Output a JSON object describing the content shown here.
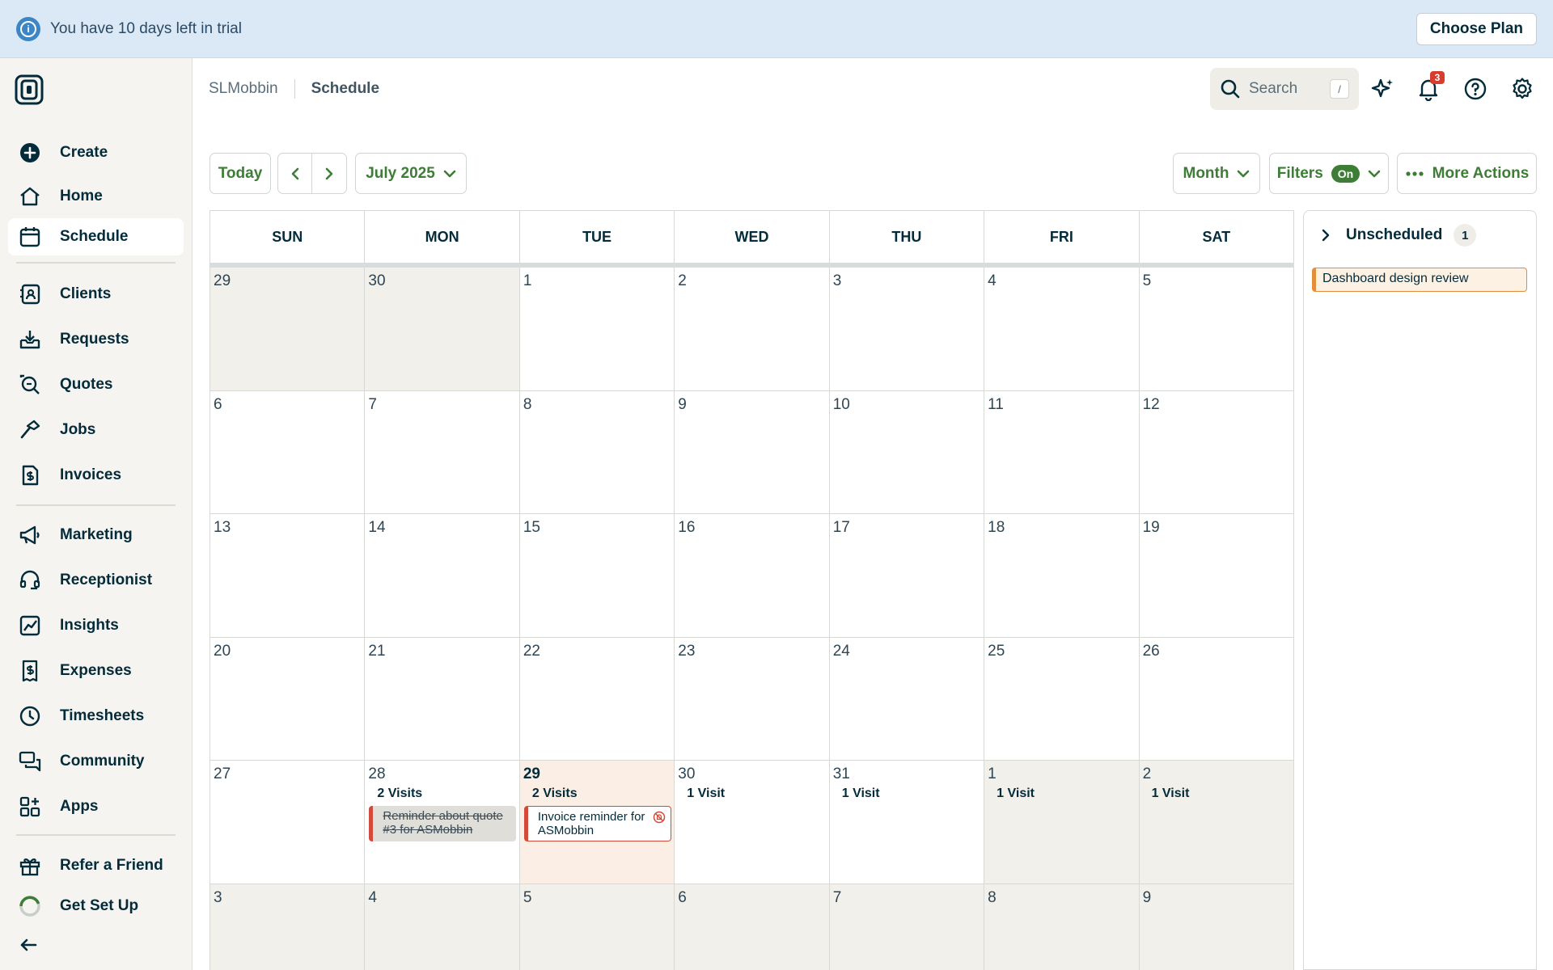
{
  "banner": {
    "message": "You have 10 days left in trial",
    "button": "Choose Plan"
  },
  "sidebar": {
    "items": [
      {
        "label": "Create",
        "icon": "plus-circle-icon"
      },
      {
        "label": "Home",
        "icon": "home-icon"
      },
      {
        "label": "Schedule",
        "icon": "calendar-icon",
        "active": true
      },
      {
        "label": "Clients",
        "icon": "address-book-icon"
      },
      {
        "label": "Requests",
        "icon": "inbox-download-icon"
      },
      {
        "label": "Quotes",
        "icon": "quote-search-icon"
      },
      {
        "label": "Jobs",
        "icon": "hammer-icon"
      },
      {
        "label": "Invoices",
        "icon": "invoice-dollar-icon"
      },
      {
        "label": "Marketing",
        "icon": "megaphone-icon"
      },
      {
        "label": "Receptionist",
        "icon": "headset-icon"
      },
      {
        "label": "Insights",
        "icon": "chart-icon"
      },
      {
        "label": "Expenses",
        "icon": "receipt-dollar-icon"
      },
      {
        "label": "Timesheets",
        "icon": "clock-icon"
      },
      {
        "label": "Community",
        "icon": "chat-bubbles-icon"
      },
      {
        "label": "Apps",
        "icon": "apps-grid-icon"
      },
      {
        "label": "Refer a Friend",
        "icon": "gift-icon"
      },
      {
        "label": "Get Set Up",
        "icon": "progress-ring-icon"
      }
    ]
  },
  "header": {
    "company": "SLMobbin",
    "page": "Schedule",
    "search_placeholder": "Search",
    "search_shortcut": "/",
    "notification_count": "3"
  },
  "toolbar": {
    "today": "Today",
    "month_label": "July 2025",
    "view": "Month",
    "filters": "Filters",
    "filters_state": "On",
    "more_actions": "More Actions"
  },
  "calendar": {
    "weekdays": [
      "SUN",
      "MON",
      "TUE",
      "WED",
      "THU",
      "FRI",
      "SAT"
    ],
    "weeks": [
      [
        {
          "d": "29",
          "out": true
        },
        {
          "d": "30",
          "out": true
        },
        {
          "d": "1"
        },
        {
          "d": "2"
        },
        {
          "d": "3"
        },
        {
          "d": "4"
        },
        {
          "d": "5"
        }
      ],
      [
        {
          "d": "6"
        },
        {
          "d": "7"
        },
        {
          "d": "8"
        },
        {
          "d": "9"
        },
        {
          "d": "10"
        },
        {
          "d": "11"
        },
        {
          "d": "12"
        }
      ],
      [
        {
          "d": "13"
        },
        {
          "d": "14"
        },
        {
          "d": "15"
        },
        {
          "d": "16"
        },
        {
          "d": "17"
        },
        {
          "d": "18"
        },
        {
          "d": "19"
        }
      ],
      [
        {
          "d": "20"
        },
        {
          "d": "21"
        },
        {
          "d": "22"
        },
        {
          "d": "23"
        },
        {
          "d": "24"
        },
        {
          "d": "25"
        },
        {
          "d": "26"
        }
      ],
      [
        {
          "d": "27"
        },
        {
          "d": "28",
          "visits": "2 Visits",
          "event": {
            "text": "Reminder about quote #3 for ASMobbin",
            "status": "done"
          }
        },
        {
          "d": "29",
          "today": true,
          "visits": "2 Visits",
          "event": {
            "text": "Invoice reminder for ASMobbin",
            "status": "overdue"
          }
        },
        {
          "d": "30",
          "visits": "1 Visit"
        },
        {
          "d": "31",
          "visits": "1 Visit"
        },
        {
          "d": "1",
          "out": true,
          "visits": "1 Visit"
        },
        {
          "d": "2",
          "out": true,
          "visits": "1 Visit"
        }
      ],
      [
        {
          "d": "3",
          "out": true
        },
        {
          "d": "4",
          "out": true
        },
        {
          "d": "5",
          "out": true
        },
        {
          "d": "6",
          "out": true
        },
        {
          "d": "7",
          "out": true
        },
        {
          "d": "8",
          "out": true
        },
        {
          "d": "9",
          "out": true
        }
      ]
    ]
  },
  "unscheduled": {
    "title": "Unscheduled",
    "count": "1",
    "items": [
      "Dashboard design review"
    ]
  },
  "colors": {
    "accent_green": "#3d7d36",
    "banner_bg": "#dbe8f5",
    "sidebar_bg": "#f5f4f0",
    "today_bg": "#fbeee4",
    "event_red": "#d44a3a",
    "unscheduled_orange": "#e48d3a"
  }
}
